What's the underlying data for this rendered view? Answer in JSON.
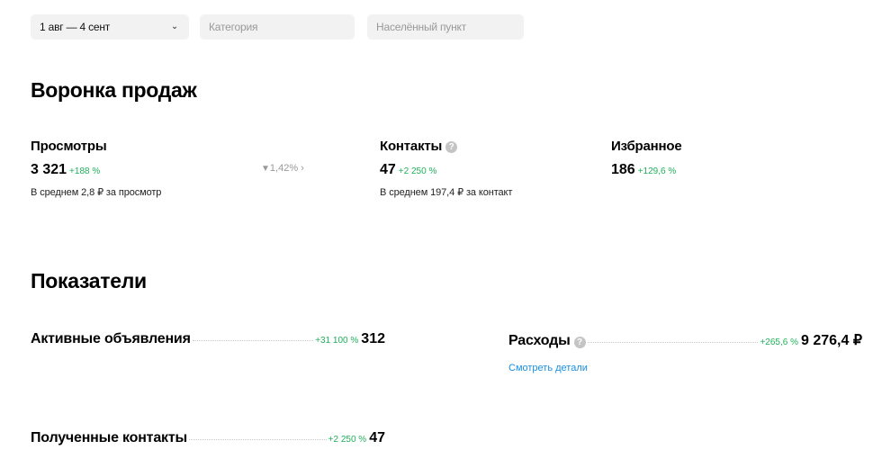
{
  "filters": {
    "date": "1 авг — 4 сент",
    "category_placeholder": "Категория",
    "location_placeholder": "Населённый пункт"
  },
  "funnel": {
    "title": "Воронка продаж",
    "views": {
      "title": "Просмотры",
      "value": "3 321",
      "delta": "+188 %",
      "avg": "В среднем 2,8 ₽ за просмотр"
    },
    "conversion": "1,42%",
    "contacts": {
      "title": "Контакты",
      "value": "47",
      "delta": "+2 250 %",
      "avg": "В среднем 197,4 ₽ за контакт"
    },
    "favorites": {
      "title": "Избранное",
      "value": "186",
      "delta": "+129,6 %"
    }
  },
  "metrics": {
    "title": "Показатели",
    "active_ads": {
      "label": "Активные объявления",
      "delta": "+31 100 %",
      "value": "312"
    },
    "expenses": {
      "label": "Расходы",
      "delta": "+265,6 %",
      "value": "9 276,4 ₽",
      "details_link": "Смотреть детали"
    },
    "received_contacts": {
      "label": "Полученные контакты",
      "delta": "+2 250 %",
      "value": "47"
    }
  },
  "colors": {
    "positive_delta": "#20b05a",
    "link": "#1a8fe0",
    "filter_bg": "#f2f2f2"
  }
}
